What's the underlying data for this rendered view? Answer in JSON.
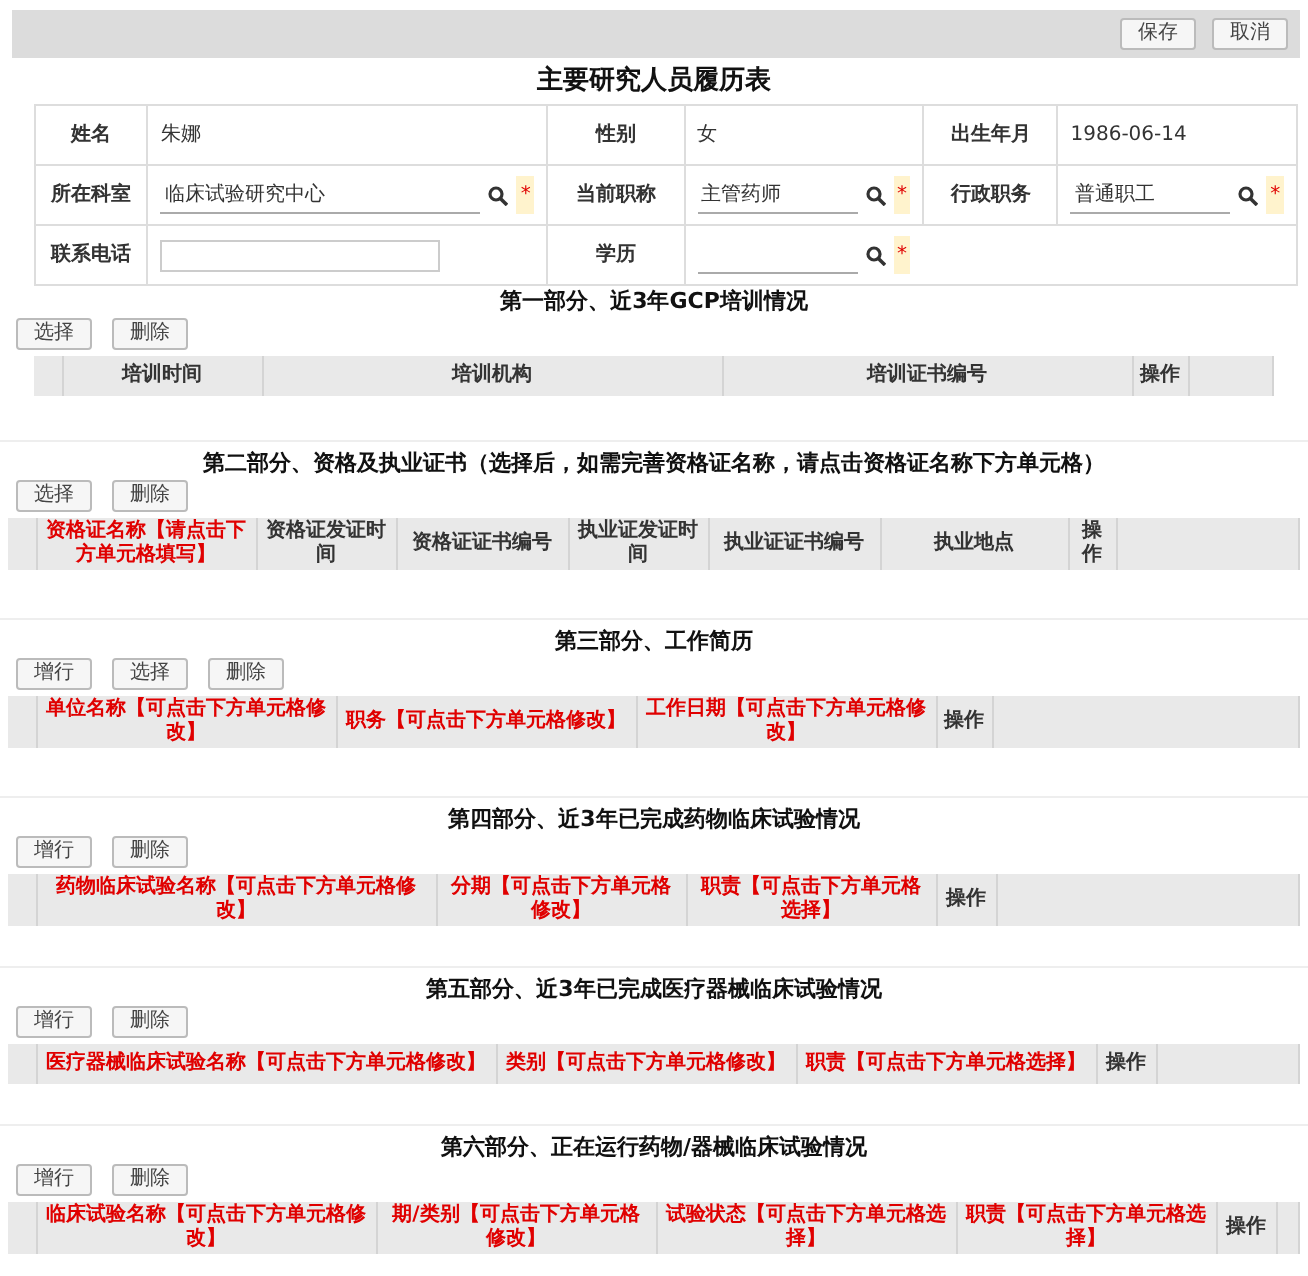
{
  "toolbar": {
    "buttons": [
      "保存",
      "取消"
    ]
  },
  "title": "主要研究人员履历表",
  "info_rows": [
    [
      {
        "label": "姓名",
        "value": "朱娜",
        "kind": "text"
      },
      {
        "label": "性别",
        "value": "女",
        "kind": "text"
      },
      {
        "label": "出生年月",
        "value": "1986-06-14",
        "kind": "text"
      }
    ],
    [
      {
        "label": "所在科室",
        "value": "临床试验研究中心",
        "kind": "lookup",
        "required_mark": "*"
      },
      {
        "label": "当前职称",
        "value": "主管药师",
        "kind": "lookup",
        "required_mark": "*"
      },
      {
        "label": "行政职务",
        "value": "普通职工",
        "kind": "lookup",
        "required_mark": "*"
      }
    ],
    [
      {
        "label": "联系电话",
        "kind": "input"
      },
      {
        "label": "学历",
        "kind": "lookup",
        "required_mark": "*"
      }
    ]
  ],
  "sections": [
    {
      "title": "第一部分、近3年GCP培训情况",
      "buttons": [
        "选择",
        "删除"
      ],
      "columns": [
        {
          "label": "培训时间",
          "color": "#333333"
        },
        {
          "label": "培训机构",
          "color": "#333333"
        },
        {
          "label": "培训证书编号",
          "color": "#333333"
        },
        {
          "label": "操作",
          "color": "#333333"
        }
      ]
    },
    {
      "title": "第二部分、资格及执业证书（选择后，如需完善资格证名称，请点击资格证名称下方单元格）",
      "buttons": [
        "选择",
        "删除"
      ],
      "columns": [
        {
          "label": "资格证名称【请点击下方单元格填写】",
          "color": "#e00000"
        },
        {
          "label": "资格证发证时间",
          "color": "#333333"
        },
        {
          "label": "资格证证书编号",
          "color": "#333333"
        },
        {
          "label": "执业证发证时间",
          "color": "#333333"
        },
        {
          "label": "执业证证书编号",
          "color": "#333333"
        },
        {
          "label": "执业地点",
          "color": "#333333"
        },
        {
          "label": "操作",
          "color": "#333333"
        }
      ]
    },
    {
      "title": "第三部分、工作简历",
      "buttons": [
        "增行",
        "选择",
        "删除"
      ],
      "columns": [
        {
          "label": "单位名称【可点击下方单元格修改】",
          "color": "#e00000"
        },
        {
          "label": "职务【可点击下方单元格修改】",
          "color": "#e00000"
        },
        {
          "label": "工作日期【可点击下方单元格修改】",
          "color": "#e00000"
        },
        {
          "label": "操作",
          "color": "#333333"
        }
      ]
    },
    {
      "title": "第四部分、近3年已完成药物临床试验情况",
      "buttons": [
        "增行",
        "删除"
      ],
      "columns": [
        {
          "label": "药物临床试验名称【可点击下方单元格修改】",
          "color": "#e00000"
        },
        {
          "label": "分期【可点击下方单元格修改】",
          "color": "#e00000"
        },
        {
          "label": "职责【可点击下方单元格选择】",
          "color": "#e00000"
        },
        {
          "label": "操作",
          "color": "#333333"
        }
      ]
    },
    {
      "title": "第五部分、近3年已完成医疗器械临床试验情况",
      "buttons": [
        "增行",
        "删除"
      ],
      "columns": [
        {
          "label": "医疗器械临床试验名称【可点击下方单元格修改】",
          "color": "#e00000"
        },
        {
          "label": "类别【可点击下方单元格修改】",
          "color": "#e00000"
        },
        {
          "label": "职责【可点击下方单元格选择】",
          "color": "#e00000"
        },
        {
          "label": "操作",
          "color": "#333333"
        }
      ]
    },
    {
      "title": "第六部分、正在运行药物/器械临床试验情况",
      "buttons": [
        "增行",
        "删除"
      ],
      "columns": [
        {
          "label": "临床试验名称【可点击下方单元格修改】",
          "color": "#e00000"
        },
        {
          "label": "期/类别【可点击下方单元格修改】",
          "color": "#e00000"
        },
        {
          "label": "试验状态【可点击下方单元格选择】",
          "color": "#e00000"
        },
        {
          "label": "职责【可点击下方单元格选择】",
          "color": "#e00000"
        },
        {
          "label": "操作",
          "color": "#333333"
        }
      ]
    }
  ]
}
